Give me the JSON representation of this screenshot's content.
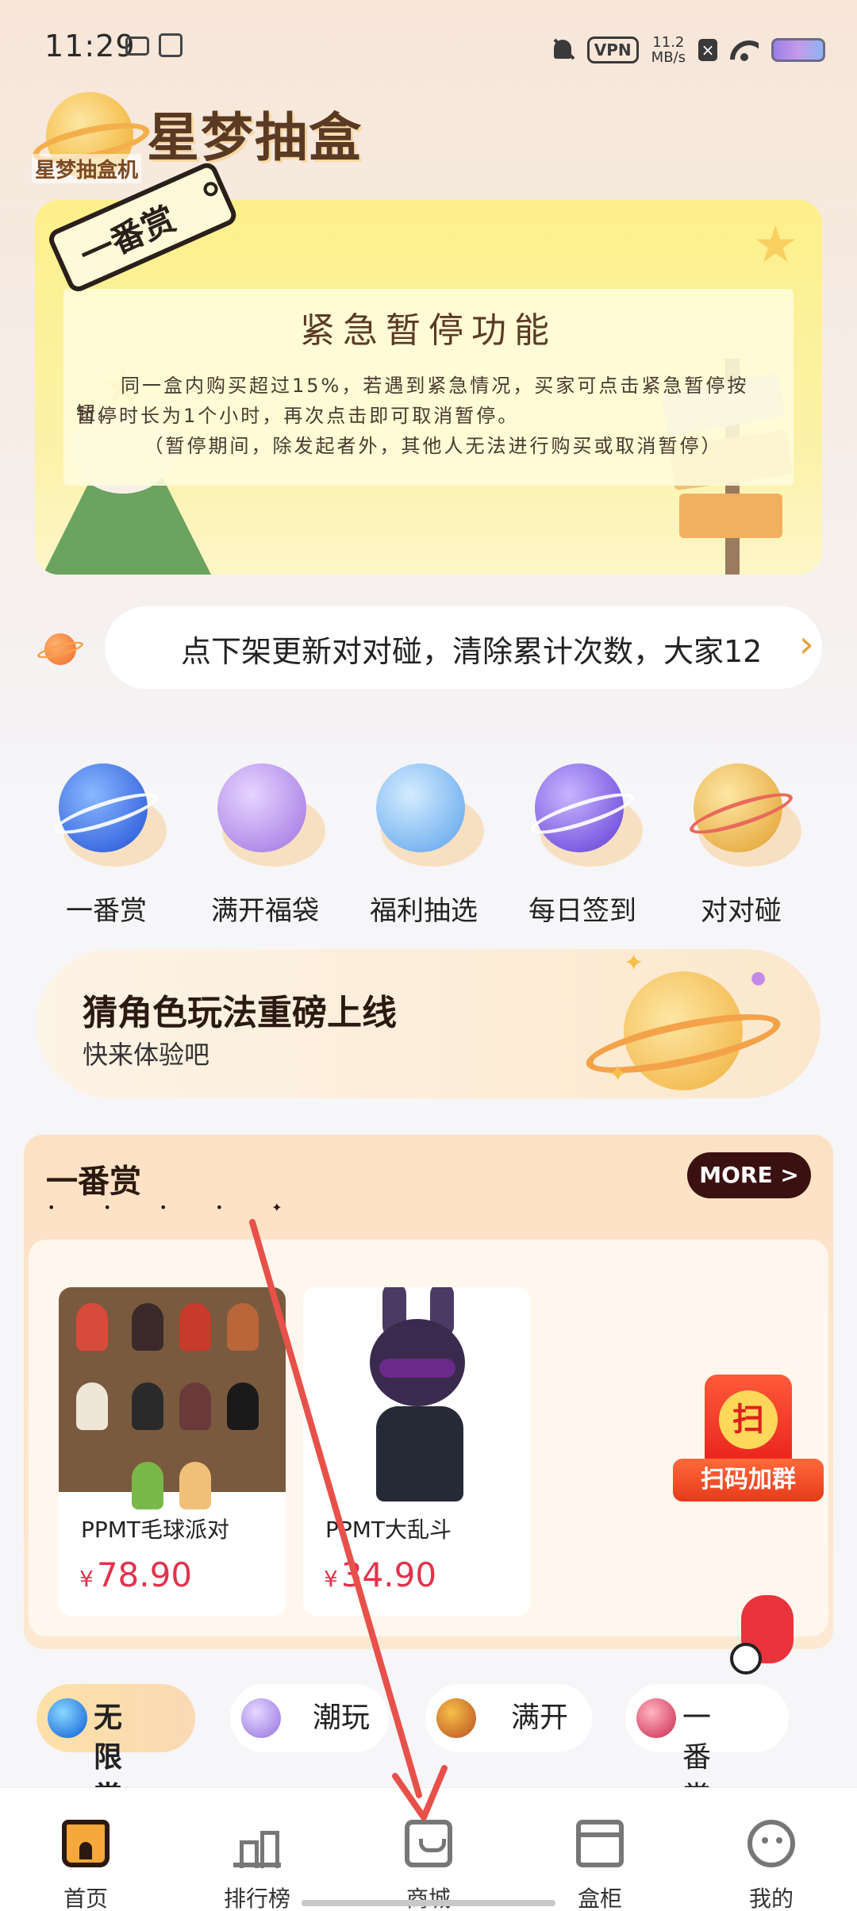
{
  "status_bar": {
    "time": "11:29",
    "vpn": "VPN",
    "speed_value": "11.2",
    "speed_unit": "MB/s",
    "icons": [
      "sim-icon",
      "screen-record-icon",
      "mute-icon",
      "vpn-icon",
      "close-icon",
      "wifi-icon",
      "battery-icon"
    ]
  },
  "app": {
    "title": "星梦抽盒机",
    "logo_small": "星梦抽盒机"
  },
  "banner": {
    "tag": "一番赏",
    "title": "紧急暂停功能",
    "line1": "同一盒内购买超过15%，若遇到紧急情况，买家可点击紧急暂停按钮。",
    "line2": "暂停时长为1个小时，再次点击即可取消暂停。",
    "line3": "（暂停期间，除发起者外，其他人无法进行购买或取消暂停）"
  },
  "notice": {
    "text": "点下架更新对对碰，清除累计次数，大家12",
    "arrow": "›"
  },
  "categories": [
    {
      "label": "一番赏",
      "icon": "blue-planet-icon",
      "color": "#4f86e8"
    },
    {
      "label": "满开福袋",
      "icon": "purple-planet-icon",
      "color": "#b48ae8"
    },
    {
      "label": "福利抽选",
      "icon": "lightblue-planet-icon",
      "color": "#7fb8f0"
    },
    {
      "label": "每日签到",
      "icon": "violet-planet-icon",
      "color": "#8a6ae8"
    },
    {
      "label": "对对碰",
      "icon": "gold-planet-icon",
      "color": "#e8b84a"
    }
  ],
  "promo": {
    "title": "猜角色玩法重磅上线",
    "subtitle": "快来体验吧"
  },
  "section": {
    "title": "一番赏",
    "more": "MORE >",
    "products": [
      {
        "name": "PPMT毛球派对",
        "currency": "¥",
        "price": "78.90"
      },
      {
        "name": "PPMT大乱斗",
        "currency": "¥",
        "price": "34.90"
      }
    ],
    "qr_icon": "扫",
    "qr_label": "扫码加群"
  },
  "filter_tabs": [
    {
      "label": "无限赏",
      "active": true,
      "color": "#3a8ae8"
    },
    {
      "label": "潮玩",
      "active": false,
      "color": "#b8a0f0"
    },
    {
      "label": "满开",
      "active": false,
      "color": "#e8a03a"
    },
    {
      "label": "一番赏",
      "active": false,
      "color": "#e86a7a"
    }
  ],
  "bottom_nav": [
    {
      "label": "首页",
      "icon": "home-icon",
      "active": true
    },
    {
      "label": "排行榜",
      "icon": "ranking-icon",
      "active": false
    },
    {
      "label": "商城",
      "icon": "shop-icon",
      "active": false
    },
    {
      "label": "盒柜",
      "icon": "box-cabinet-icon",
      "active": false
    },
    {
      "label": "我的",
      "icon": "profile-icon",
      "active": false
    }
  ],
  "colors": {
    "accent": "#e0334a",
    "brand_brown": "#5b3a24",
    "annotation_arrow": "#e8504a"
  }
}
